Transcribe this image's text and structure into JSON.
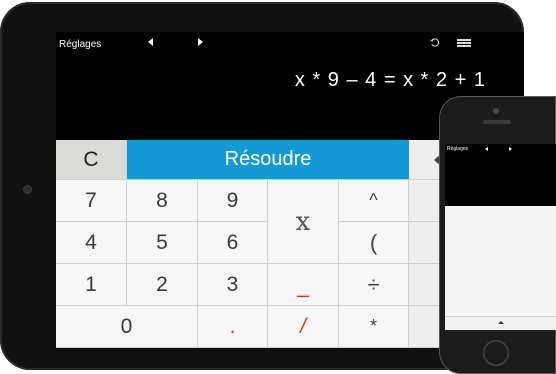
{
  "topbar": {
    "settings_label": "Réglages"
  },
  "display": {
    "expression": "x * 9 – 4 = x * 2 + 1"
  },
  "keypad": {
    "clear": "C",
    "solve": "Résoudre",
    "digits": {
      "d7": "7",
      "d8": "8",
      "d9": "9",
      "d4": "4",
      "d5": "5",
      "d6": "6",
      "d1": "1",
      "d2": "2",
      "d3": "3",
      "d0": "0"
    },
    "variable": "x",
    "dot": ".",
    "fraction_bar": "_",
    "divide_slash": "/",
    "power": "^",
    "open_paren": "(",
    "divide": "÷",
    "multiply": "*"
  },
  "iphone": {
    "settings_label": "Réglages"
  },
  "colors": {
    "solve": "#1598d6",
    "red_keys": "#d9312f",
    "clear": "#dbdbd7"
  },
  "icons": [
    "back-arrow-icon",
    "forward-arrow-icon",
    "undo-icon",
    "menu-icon",
    "backspace-icon"
  ]
}
